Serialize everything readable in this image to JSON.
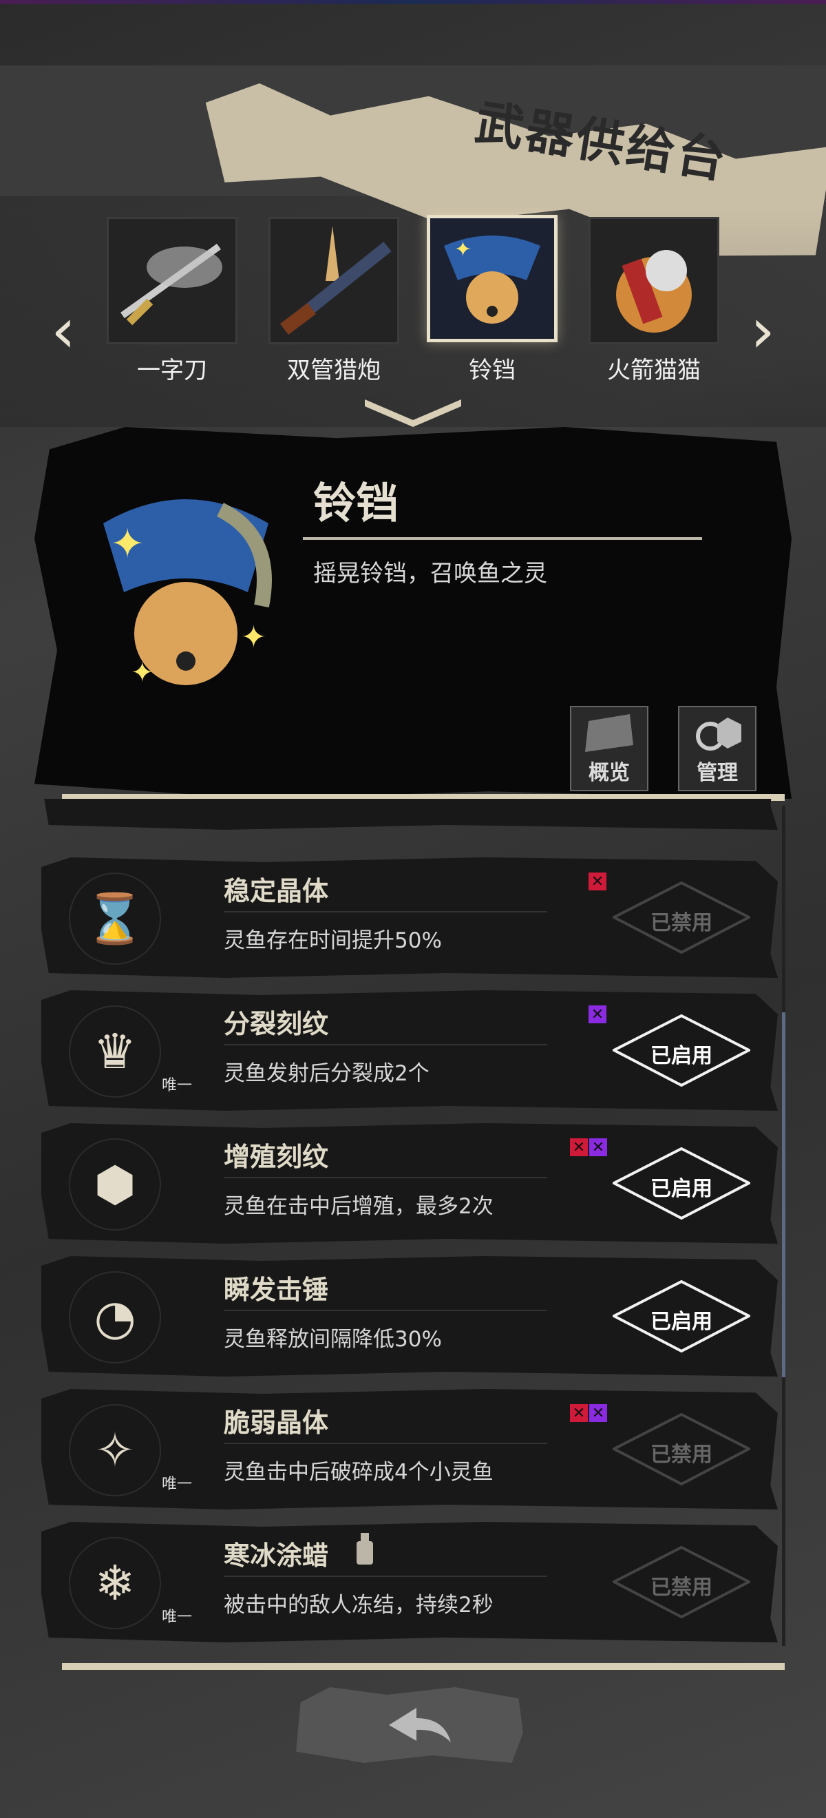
{
  "header": {
    "title": "武器供给台"
  },
  "weapons": [
    {
      "label": "一字刀",
      "icon": "katana-icon",
      "selected": false
    },
    {
      "label": "双管猎炮",
      "icon": "shotgun-icon",
      "selected": false
    },
    {
      "label": "铃铛",
      "icon": "bell-icon",
      "selected": true
    },
    {
      "label": "火箭猫猫",
      "icon": "rocket-cat-icon",
      "selected": false
    }
  ],
  "detail": {
    "name": "铃铛",
    "desc": "摇晃铃铛，召唤鱼之灵",
    "overview_label": "概览",
    "manage_label": "管理"
  },
  "upgrades": [
    {
      "name": "稳定晶体",
      "desc": "灵鱼存在时间提升50%",
      "icon": "hourglass-sword-icon",
      "unique": "",
      "marks": [
        "red"
      ],
      "status": "已禁用",
      "enabled": false
    },
    {
      "name": "分裂刻纹",
      "desc": "灵鱼发射后分裂成2个",
      "icon": "split-crown-icon",
      "unique": "唯一",
      "marks": [
        "purple"
      ],
      "status": "已启用",
      "enabled": true
    },
    {
      "name": "增殖刻纹",
      "desc": "灵鱼在击中后增殖，最多2次",
      "icon": "hexagons-icon",
      "unique": "",
      "marks": [
        "red",
        "purple"
      ],
      "status": "已启用",
      "enabled": true
    },
    {
      "name": "瞬发击锤",
      "desc": "灵鱼释放间隔降低30%",
      "icon": "stopwatch-icon",
      "unique": "",
      "marks": [],
      "status": "已启用",
      "enabled": true
    },
    {
      "name": "脆弱晶体",
      "desc": "灵鱼击中后破碎成4个小灵鱼",
      "icon": "shattered-crystal-icon",
      "unique": "唯一",
      "marks": [
        "red",
        "purple"
      ],
      "status": "已禁用",
      "enabled": false
    },
    {
      "name": "寒冰涂蜡",
      "desc": "被击中的敌人冻结，持续2秒",
      "icon": "snowflake-icon",
      "unique": "唯一",
      "marks": [],
      "status": "已禁用",
      "enabled": false
    }
  ],
  "colors": {
    "red_mark": "#d01a3a",
    "purple_mark": "#8a2be2",
    "cream": "#d8cfb6"
  }
}
